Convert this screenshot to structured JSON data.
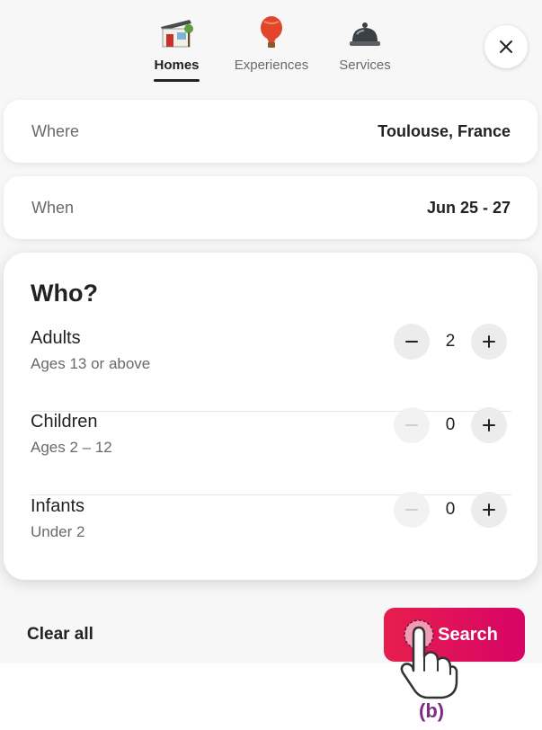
{
  "tabs": [
    {
      "label": "Homes",
      "icon": "house-icon",
      "active": true
    },
    {
      "label": "Experiences",
      "icon": "hot-air-balloon-icon",
      "active": false
    },
    {
      "label": "Services",
      "icon": "service-bell-icon",
      "active": false
    }
  ],
  "close_icon": "close-icon",
  "where": {
    "label": "Where",
    "value": "Toulouse, France"
  },
  "when": {
    "label": "When",
    "value": "Jun 25 - 27"
  },
  "who": {
    "title": "Who?",
    "guests": [
      {
        "name": "Adults",
        "description": "Ages 13 or above",
        "count": "2",
        "minus_enabled": true
      },
      {
        "name": "Children",
        "description": "Ages 2 – 12",
        "count": "0",
        "minus_enabled": false
      },
      {
        "name": "Infants",
        "description": "Under 2",
        "count": "0",
        "minus_enabled": false
      }
    ]
  },
  "footer": {
    "clear_label": "Clear all",
    "search_label": "Search"
  },
  "annotation": {
    "label": "(b)"
  },
  "colors": {
    "accent": "#e61e4d",
    "accent_end": "#d70466",
    "annotation": "#7b2d83"
  }
}
